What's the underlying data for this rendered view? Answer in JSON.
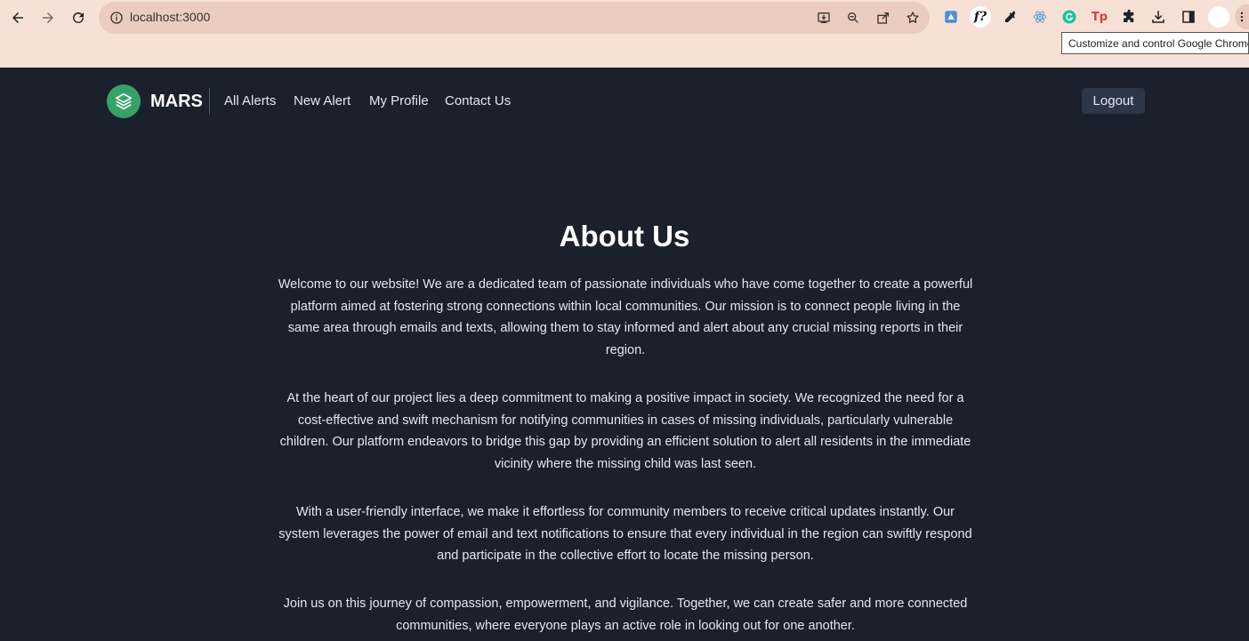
{
  "browser": {
    "url": "localhost:3000",
    "tooltip": "Customize and control Google Chrome",
    "extension_label": "f?",
    "extension_tp_label": "Tp"
  },
  "navbar": {
    "brand": "MARS",
    "links": [
      "All Alerts",
      "New Alert",
      "My Profile",
      "Contact Us"
    ],
    "logout_label": "Logout"
  },
  "content": {
    "title": "About Us",
    "paragraphs": [
      "Welcome to our website! We are a dedicated team of passionate individuals who have come together to create a powerful platform aimed at fostering strong connections within local communities. Our mission is to connect people living in the same area through emails and texts, allowing them to stay informed and alert about any crucial missing reports in their region.",
      "At the heart of our project lies a deep commitment to making a positive impact in society. We recognized the need for a cost-effective and swift mechanism for notifying communities in cases of missing individuals, particularly vulnerable children. Our platform endeavors to bridge this gap by providing an efficient solution to alert all residents in the immediate vicinity where the missing child was last seen.",
      "With a user-friendly interface, we make it effortless for community members to receive critical updates instantly. Our system leverages the power of email and text notifications to ensure that every individual in the region can swiftly respond and participate in the collective effort to locate the missing person.",
      "Join us on this journey of compassion, empowerment, and vigilance. Together, we can create safer and more connected communities, where everyone plays an active role in looking out for one another."
    ]
  },
  "colors": {
    "page_bg": "#1a202c",
    "chrome_bg": "#f7e1d7",
    "brand_accent": "#38a169",
    "logout_bg": "#2d3748"
  }
}
